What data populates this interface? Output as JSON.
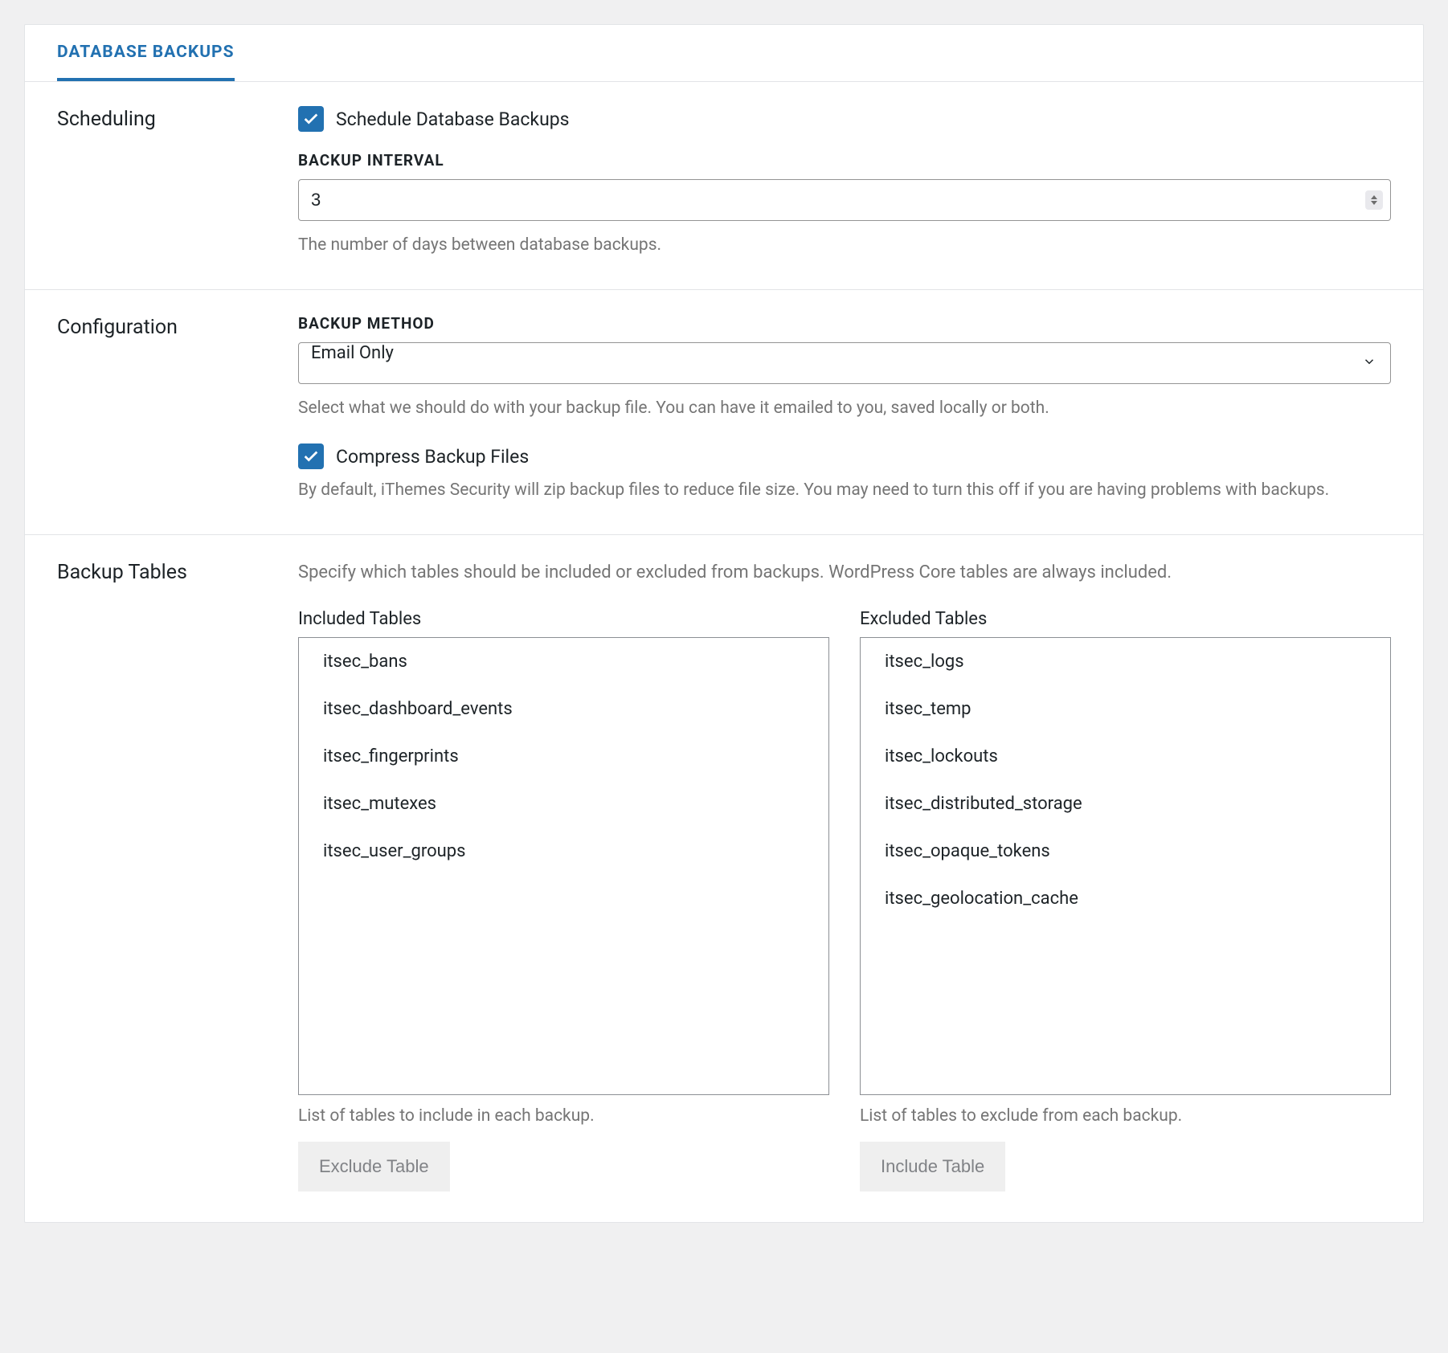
{
  "tab": {
    "label": "DATABASE BACKUPS"
  },
  "scheduling": {
    "heading": "Scheduling",
    "schedule_checkbox_label": "Schedule Database Backups",
    "interval_label": "BACKUP INTERVAL",
    "interval_value": "3",
    "interval_help": "The number of days between database backups."
  },
  "configuration": {
    "heading": "Configuration",
    "method_label": "BACKUP METHOD",
    "method_value": "Email Only",
    "method_help": "Select what we should do with your backup file. You can have it emailed to you, saved locally or both.",
    "compress_checkbox_label": "Compress Backup Files",
    "compress_help": "By default, iThemes Security will zip backup files to reduce file size. You may need to turn this off if you are having problems with backups."
  },
  "backup_tables": {
    "heading": "Backup Tables",
    "intro": "Specify which tables should be included or excluded from backups. WordPress Core tables are always included.",
    "included": {
      "title": "Included Tables",
      "items": [
        "itsec_bans",
        "itsec_dashboard_events",
        "itsec_fingerprints",
        "itsec_mutexes",
        "itsec_user_groups"
      ],
      "help": "List of tables to include in each backup.",
      "button": "Exclude Table"
    },
    "excluded": {
      "title": "Excluded Tables",
      "items": [
        "itsec_logs",
        "itsec_temp",
        "itsec_lockouts",
        "itsec_distributed_storage",
        "itsec_opaque_tokens",
        "itsec_geolocation_cache"
      ],
      "help": "List of tables to exclude from each backup.",
      "button": "Include Table"
    }
  }
}
